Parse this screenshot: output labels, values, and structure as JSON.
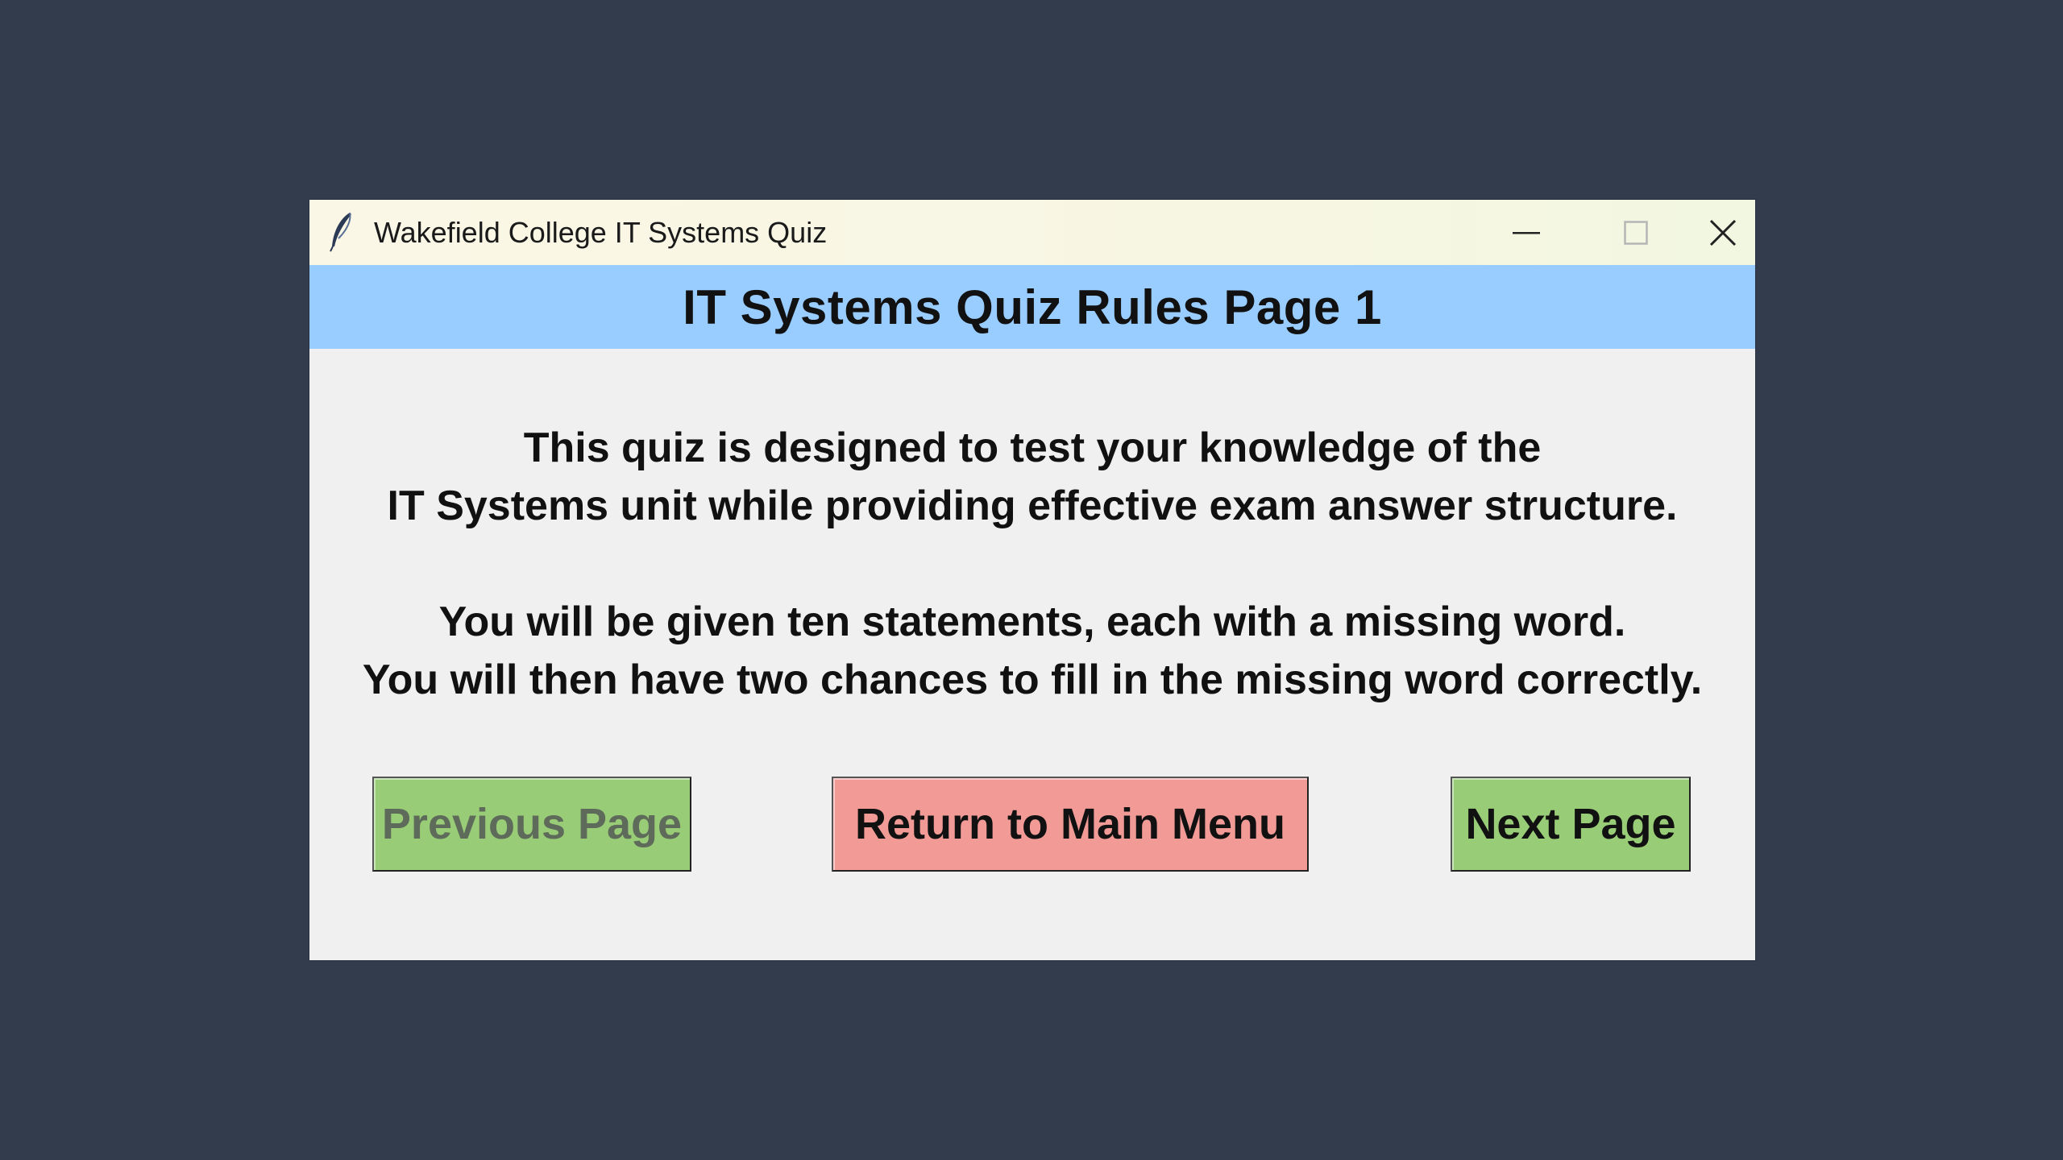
{
  "window": {
    "title": "Wakefield College IT Systems Quiz",
    "icon": "feather-icon",
    "controls": {
      "minimize": "minimize-icon",
      "maximize": "maximize-icon",
      "close": "close-icon"
    }
  },
  "header": {
    "title": "IT Systems Quiz Rules Page 1",
    "background": "#99ccff"
  },
  "rules": {
    "paragraph1": [
      "This quiz is designed to test your knowledge of the",
      "IT Systems unit while providing effective exam answer structure."
    ],
    "paragraph2": [
      "You will be given ten statements, each with a missing word.",
      "You will then have two chances to fill in the missing word correctly."
    ]
  },
  "buttons": {
    "previous": {
      "label": "Previous Page",
      "color": "#99cc77",
      "state": "disabled"
    },
    "menu": {
      "label": "Return to Main Menu",
      "color": "#f19a96"
    },
    "next": {
      "label": "Next Page",
      "color": "#99cc77"
    }
  }
}
